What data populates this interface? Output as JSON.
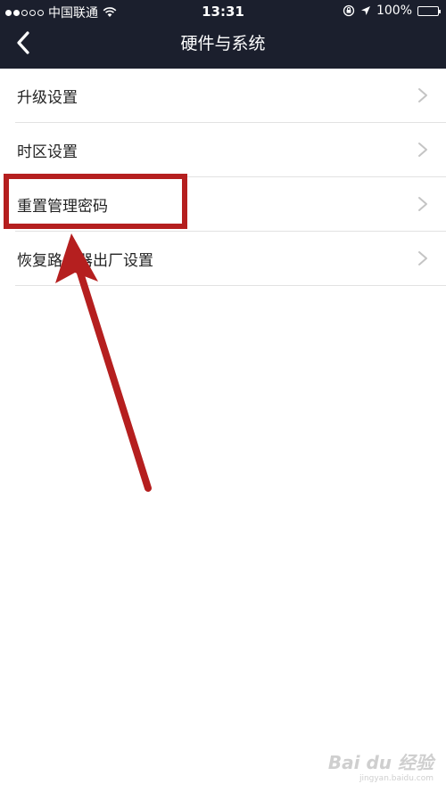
{
  "status_bar": {
    "carrier": "中国联通",
    "time": "13:31",
    "battery_percent": "100%",
    "battery_level": 1.0,
    "signal_bars_filled": 2,
    "signal_bars_total": 5
  },
  "nav": {
    "title": "硬件与系统",
    "back_icon": "chevron-left-icon"
  },
  "menu": {
    "items": [
      {
        "label": "升级设置"
      },
      {
        "label": "时区设置"
      },
      {
        "label": "重置管理密码"
      },
      {
        "label": "恢复路由器出厂设置"
      }
    ]
  },
  "annotation": {
    "color": "#b51f1f",
    "highlighted_item": "重置管理密码"
  },
  "watermark": {
    "text": "Bai du 经验",
    "sub": "jingyan.baidu.com"
  },
  "colors": {
    "header_bg": "#1b1f2d",
    "separator": "#e2e2e2"
  }
}
